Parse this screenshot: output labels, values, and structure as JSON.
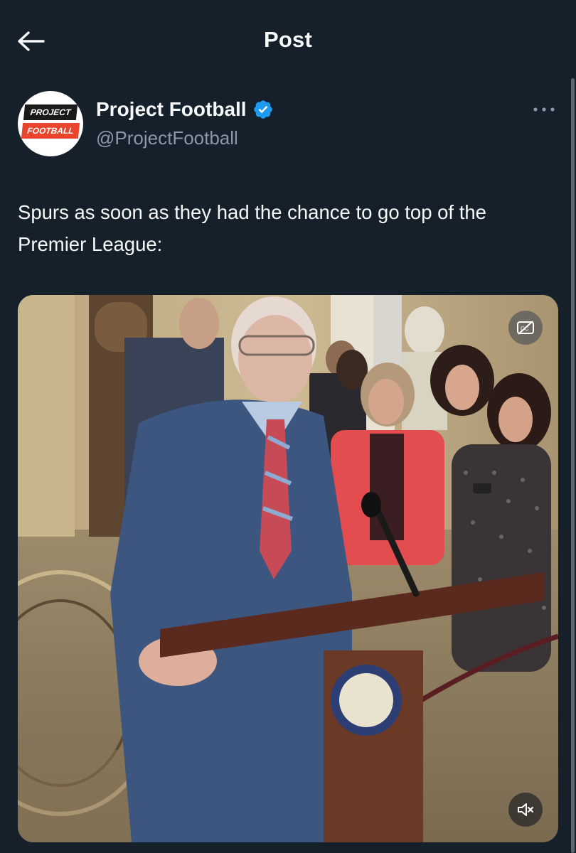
{
  "header": {
    "title": "Post",
    "back_icon": "arrow-left-icon"
  },
  "author": {
    "name": "Project Football",
    "handle": "@ProjectFootball",
    "verified": true,
    "verified_color": "#1d9bf0",
    "avatar": {
      "logo_top": "PROJECT",
      "logo_bottom": "FOOTBALL",
      "logo_accent": "#e8452c"
    }
  },
  "tweet": {
    "text": "Spurs as soon as they had the chance to go top of the Premier League:"
  },
  "media": {
    "type": "video",
    "captions_icon": "captions-off-icon",
    "mute_icon": "speaker-muted-icon"
  },
  "colors": {
    "background": "#15202b",
    "text_primary": "#f7f9f9",
    "text_secondary": "#8b98a5"
  }
}
